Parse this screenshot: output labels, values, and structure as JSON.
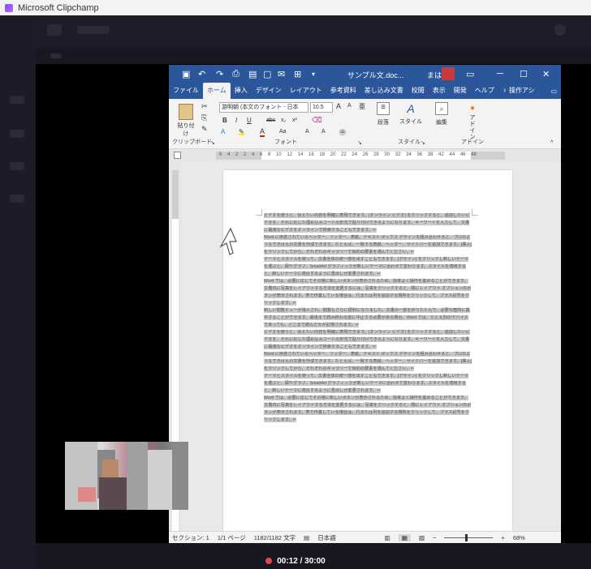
{
  "app": {
    "title": "Microsoft Clipchamp"
  },
  "word": {
    "doc_title": "サンプル文.doc...",
    "mode_label": "まは",
    "tabs": [
      "ファイル",
      "ホーム",
      "挿入",
      "デザイン",
      "レイアウト",
      "参考資料",
      "差し込み文書",
      "校閲",
      "表示",
      "開発",
      "ヘルプ",
      "操作アシ"
    ],
    "active_tab": "ホーム",
    "ribbon": {
      "paste_label": "貼り付け",
      "clipboard_group": "クリップボード",
      "font_name": "游明朝 (本文のフォント - 日本",
      "font_size": "10.5",
      "font_group": "フォント",
      "paragraph_label": "段落",
      "style_label": "スタイル",
      "style_group": "スタイル",
      "edit_label": "編集",
      "addin_label": "アドイン",
      "addin_group": "アドイン",
      "format_buttons": [
        "B",
        "I",
        "U",
        "abc",
        "x₂",
        "x²"
      ],
      "font_tools": [
        "A",
        "A",
        "Aa",
        "A",
        "A"
      ]
    },
    "ruler": "6 4 2 2 4 6 8 10 12 14 16 18 20 22 24 26 28 30 32 34 36 38 42 44 46 48",
    "document_lines": [
      "ビデオを使うと、伝えたい内容を明確に表現できます。[オンライン ビデオ] をクリックすると、追加したいビデオを、それに応じた埋め込みコードの形式で貼り付けできるようになります。キーワードを入力して、文書に最適なビデオをオンラインで検索することもできます。↵",
      "Word に用意されているヘッダー、フッター、表紙、テキスト ボックス デザインを組み合わせると、プロのようなできばえの文書を作成できます。たとえば、一致する表紙、ヘッダー、サイドバーを追加できます。[挿入] をクリックしてから、それぞれのギャラリーで目的の要素を選んでください。↵",
      "テーマとスタイルを使って、文書全体の統一感を出すこともできます。[デザイン] をクリックし新しいテーマを選ぶと、図やグラフ、SmartArt グラフィックが新しいテーマに合わせて変わります。スタイルを適用すると、新しいテーマに適合するように見出しが変更されます。↵",
      "Word では、必要に応じてその場に新しいボタンが表示されるため、効率よく操作を進めることができます。文書内に写真をレイアウトする方法を変更するには、写真をクリックすると、隣にレイアウト オプションのボタンが表示されます。表で作業している場合は、行または列を追加する場所をクリックして、プラス記号をクリックします。↵",
      "新しい閲覧ビューが導入され、閲覧もさらに便利になりました。文書の一部を折りたたんで、必要な箇所に集中することができます。最後まで読み終わる前に中止する必要がある場合、Word では、たとえ別のデバイスであっても、どこまで読んだかが記憶されます。↵",
      "ビデオを使うと、伝えたい内容を明確に表現できます。[オンライン ビデオ] をクリックすると、追加したいビデオを、それに応じた埋め込みコードの形式で貼り付けできるようになります。キーワードを入力して、文書に最適なビデオをオンラインで検索することもできます。↵",
      "Word に用意されているヘッダー、フッター、表紙、テキスト ボックス デザインを組み合わせると、プロのようなできばえの文書を作成できます。たとえば、一致する表紙、ヘッダー、サイドバーを追加できます。[挿入] をクリックしてから、それぞれのギャラリーで目的の要素を選んでください。↵",
      "テーマとスタイルを使って、文書全体の統一感を出すこともできます。[デザイン] をクリックし新しいテーマを選ぶと、図やグラフ、SmartArt グラフィックが新しいテーマに合わせて変わります。スタイルを適用すると、新しいテーマに適合するように見出しが変更されます。↵",
      "Word では、必要に応じてその場に新しいボタンが表示されるため、効率よく操作を進めることができます。文書内に写真をレイアウトする方法を変更するには、写真をクリックすると、隣にレイアウト オプションのボタンが表示されます。表で作業している場合は、行または列を追加する場所をクリックして、プラス記号をクリックします。↵"
    ],
    "status": {
      "section": "セクション: 1",
      "page": "1/1 ページ",
      "words": "1182/1182 文字",
      "language": "日本語",
      "zoom": "68%"
    }
  },
  "recorder": {
    "time": "00:12 / 30:00"
  },
  "colors": {
    "word_blue": "#2b579a",
    "record_red": "#e04848"
  }
}
